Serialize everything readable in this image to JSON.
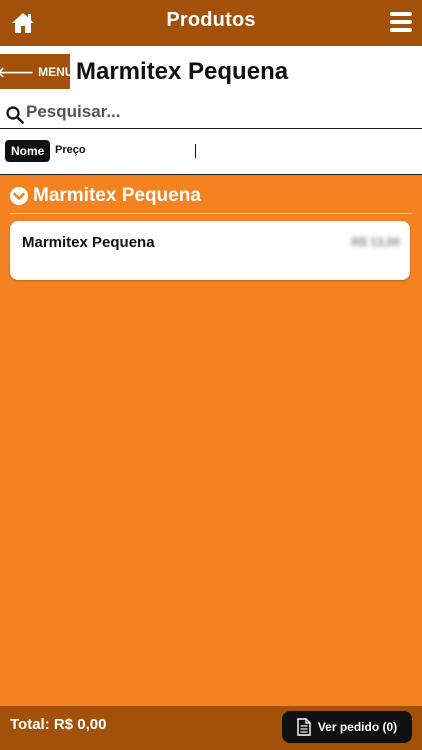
{
  "topbar": {
    "title": "Produtos",
    "home_icon": "home-icon",
    "menu_icon": "hamburger-icon"
  },
  "header": {
    "back_label": "MENU",
    "back_icon": "arrow-left-icon",
    "title": "Marmitex Pequena"
  },
  "search": {
    "placeholder": "Pesquisar...",
    "value": "",
    "icon": "search-icon"
  },
  "sort": {
    "active_label": "Nome",
    "other_label": "Preço"
  },
  "category": {
    "icon": "chevron-down-circle-icon",
    "label": "Marmitex Pequena"
  },
  "products": [
    {
      "name": "Marmitex Pequena",
      "price": "R$ 13,00"
    }
  ],
  "footer": {
    "total": "Total: R$ 0,00",
    "order_label": "Ver pedido (0)",
    "order_icon": "document-icon"
  },
  "colors": {
    "brown": "#a3510a",
    "orange": "#f58220",
    "black": "#111111",
    "white": "#ffffff"
  }
}
